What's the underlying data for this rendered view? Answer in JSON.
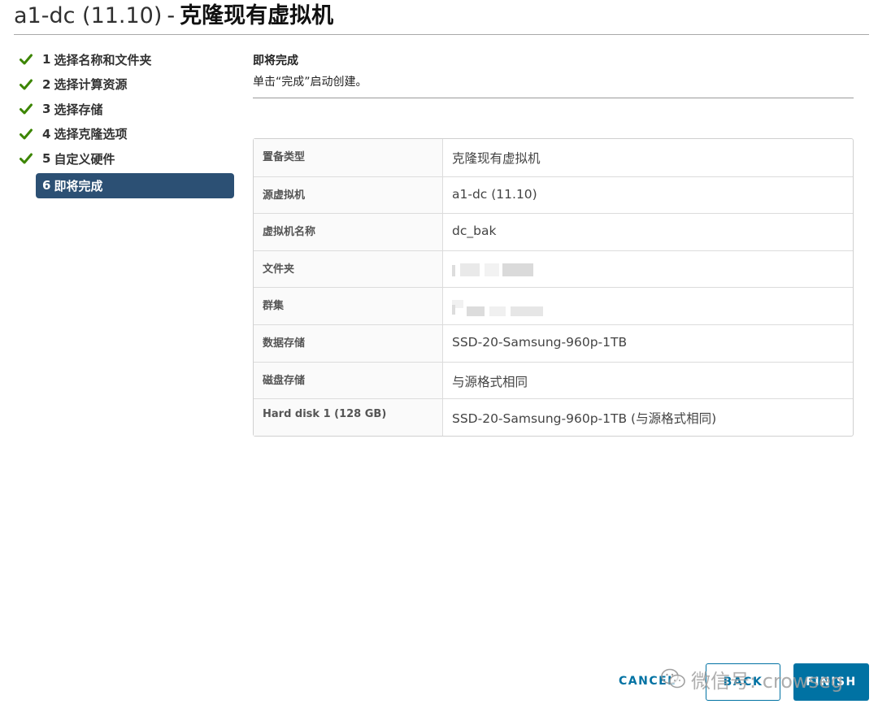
{
  "window": {
    "vm_name": "a1-dc (11.10)",
    "separator": "-",
    "action_title": "克隆现有虚拟机"
  },
  "steps": [
    {
      "number": "1",
      "label": "选择名称和文件夹",
      "state": "completed"
    },
    {
      "number": "2",
      "label": "选择计算资源",
      "state": "completed"
    },
    {
      "number": "3",
      "label": "选择存储",
      "state": "completed"
    },
    {
      "number": "4",
      "label": "选择克隆选项",
      "state": "completed"
    },
    {
      "number": "5",
      "label": "自定义硬件",
      "state": "completed"
    },
    {
      "number": "6",
      "label": "即将完成",
      "state": "active"
    }
  ],
  "content": {
    "heading": "即将完成",
    "instruction": "单击“完成”启动创建。"
  },
  "summary": [
    {
      "label": "置备类型",
      "value": "克隆现有虚拟机"
    },
    {
      "label": "源虚拟机",
      "value": "a1-dc (11.10)"
    },
    {
      "label": "虚拟机名称",
      "value": "dc_bak"
    },
    {
      "label": "文件夹",
      "value": null,
      "redacted": true
    },
    {
      "label": "群集",
      "value": null,
      "redacted": true
    },
    {
      "label": "数据存储",
      "value": "SSD-20-Samsung-960p-1TB"
    },
    {
      "label": "磁盘存储",
      "value": "与源格式相同"
    },
    {
      "label": "Hard disk 1 (128 GB)",
      "value": "SSD-20-Samsung-960p-1TB (与源格式相同)"
    }
  ],
  "footer": {
    "cancel_label": "CANCEL",
    "back_label": "BACK",
    "finish_label": "FINISH"
  },
  "watermark": {
    "text": "微信号: crowseg",
    "icon": "wechat-icon"
  },
  "colors": {
    "accent": "#0072a3",
    "active_step_bg": "#2c5074",
    "check_green": "#3c8500"
  },
  "icons": {
    "completed_step": "checkmark-icon"
  }
}
